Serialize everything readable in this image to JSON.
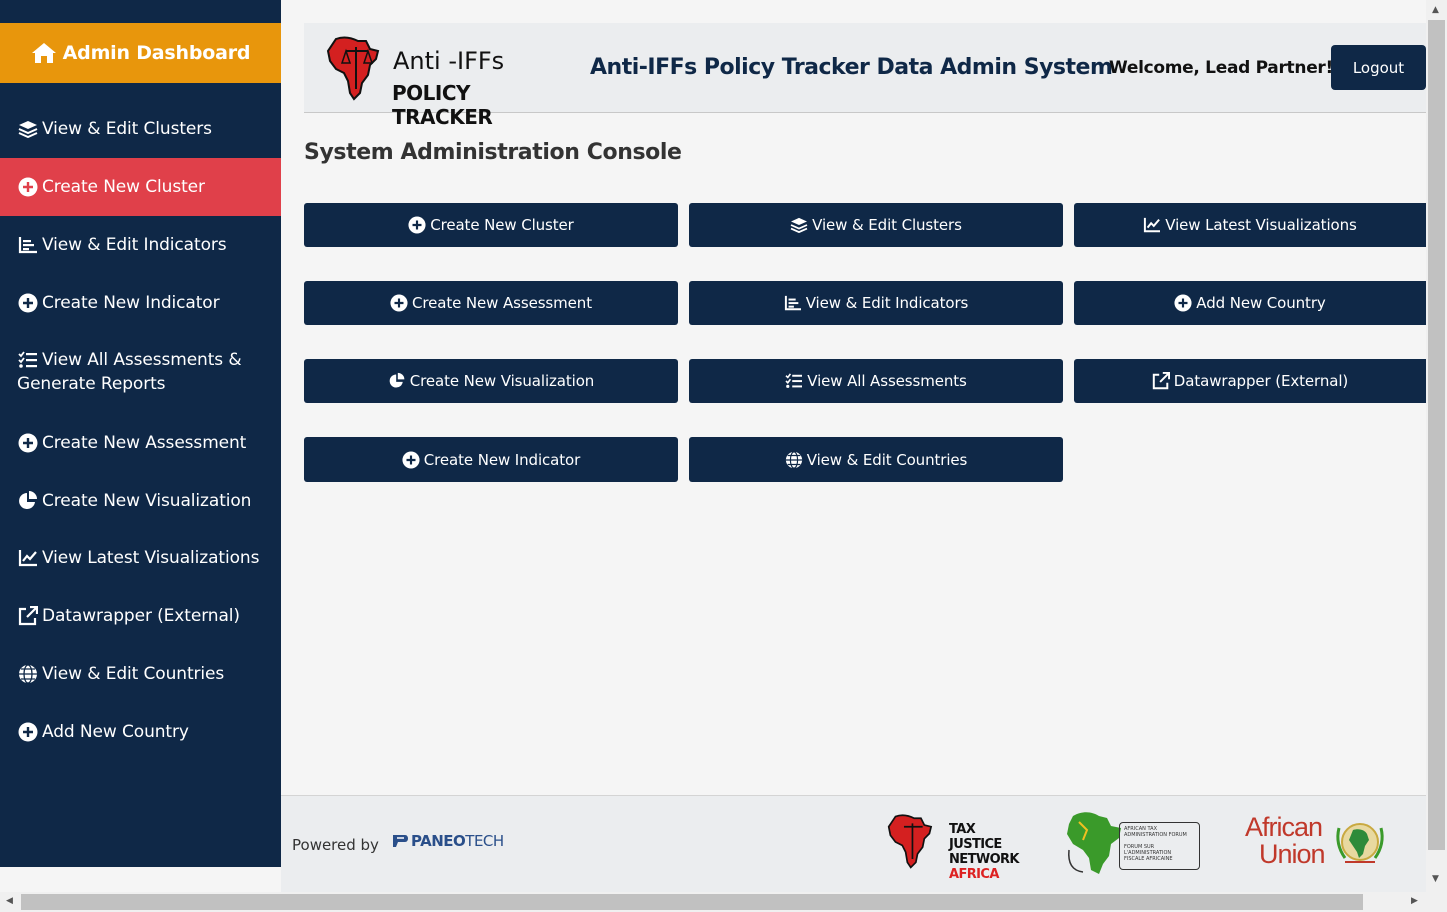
{
  "sidebar": {
    "brand_label": "Admin Dashboard",
    "items": [
      {
        "label": "View & Edit Clusters",
        "icon": "layers-icon"
      },
      {
        "label": "Create New Cluster",
        "icon": "plus-circle-icon",
        "active": true
      },
      {
        "label": "View & Edit Indicators",
        "icon": "list-chart-icon"
      },
      {
        "label": "Create New Indicator",
        "icon": "plus-circle-icon"
      },
      {
        "label": "View All Assessments &",
        "label2": "Generate Reports",
        "icon": "checklist-icon"
      },
      {
        "label": "Create New Assessment",
        "icon": "plus-circle-icon"
      },
      {
        "label": "Create New Visualization",
        "icon": "pie-chart-icon"
      },
      {
        "label": "View Latest Visualizations",
        "icon": "line-chart-icon"
      },
      {
        "label": "Datawrapper (External)",
        "icon": "external-link-icon"
      },
      {
        "label": "View & Edit Countries",
        "icon": "globe-icon"
      },
      {
        "label": "Add New Country",
        "icon": "plus-circle-icon"
      }
    ]
  },
  "header": {
    "logo_line1": "Anti -IFFs",
    "logo_line2": "POLICY TRACKER",
    "title": "Anti-IFFs Policy Tracker Data Admin System",
    "welcome": "Welcome, Lead Partner!",
    "logout_label": "Logout"
  },
  "main": {
    "console_title": "System Administration Console",
    "tiles": [
      {
        "label": "Create New Cluster",
        "icon": "plus-circle-icon"
      },
      {
        "label": "View & Edit Clusters",
        "icon": "layers-icon"
      },
      {
        "label": "View Latest Visualizations",
        "icon": "line-chart-icon"
      },
      {
        "label": "Create New Assessment",
        "icon": "plus-circle-icon"
      },
      {
        "label": "View & Edit Indicators",
        "icon": "list-chart-icon"
      },
      {
        "label": "Add New Country",
        "icon": "plus-circle-icon"
      },
      {
        "label": "Create New Visualization",
        "icon": "pie-chart-icon"
      },
      {
        "label": "View All Assessments",
        "icon": "checklist-icon"
      },
      {
        "label": "Datawrapper (External)",
        "icon": "external-link-icon"
      },
      {
        "label": "Create New Indicator",
        "icon": "plus-circle-icon"
      },
      {
        "label": "View & Edit Countries",
        "icon": "globe-icon"
      }
    ]
  },
  "footer": {
    "powered_by": "Powered by",
    "paneo_bold": "PANEO",
    "paneo_light": "TECH",
    "tjn_line1": "TAX JUSTICE",
    "tjn_line2": "NETWORK",
    "tjn_line3": "AFRICA",
    "ataf_line1": "AFRICAN TAX",
    "ataf_line2": "ADMINISTRATION FORUM",
    "ataf_line3": "FORUM SUR",
    "ataf_line4": "L'ADMINISTRATION",
    "ataf_line5": "FISCALE AFRICAINE",
    "au_line1": "African",
    "au_line2": "Union"
  },
  "colors": {
    "navy": "#0f2847",
    "orange": "#e8960c",
    "active_red": "#e0404a"
  }
}
